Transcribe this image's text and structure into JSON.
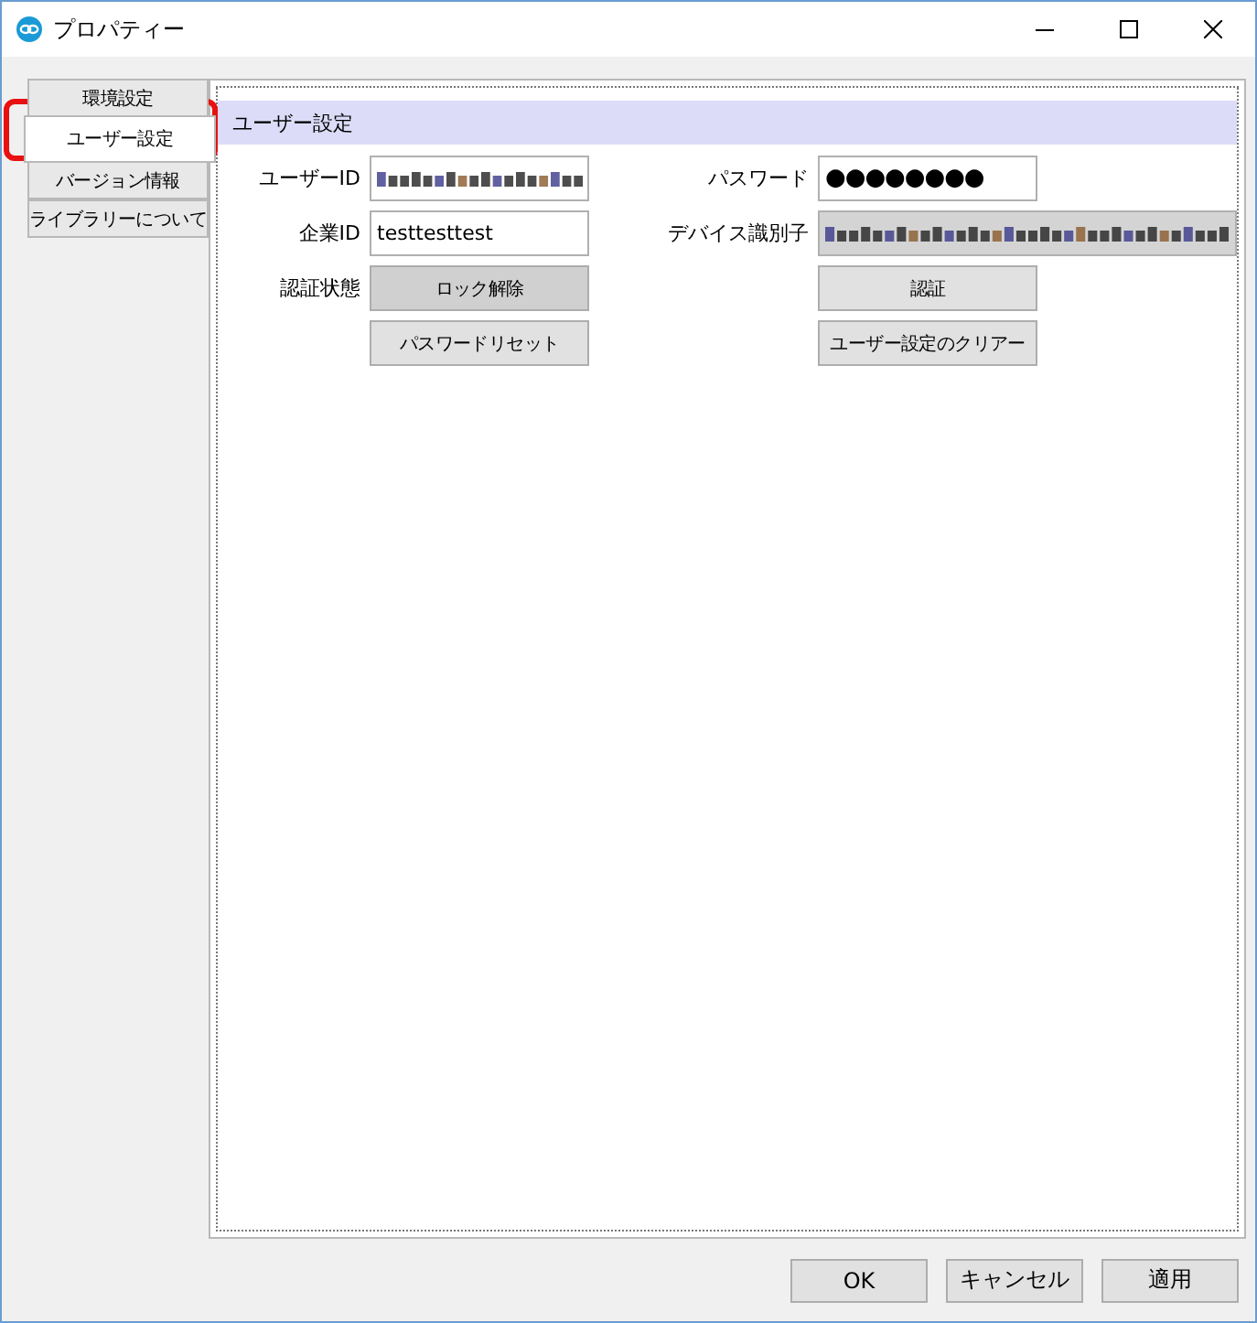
{
  "window": {
    "title": "プロパティー"
  },
  "tabs": [
    {
      "label": "環境設定",
      "selected": false
    },
    {
      "label": "ユーザー設定",
      "selected": true
    },
    {
      "label": "バージョン情報",
      "selected": false
    },
    {
      "label": "ライブラリーについて",
      "selected": false
    }
  ],
  "section": {
    "title": "ユーザー設定"
  },
  "left_rows": [
    {
      "label": "ユーザーID",
      "kind": "field",
      "redacted": true,
      "disabled": false
    },
    {
      "label": "企業ID",
      "kind": "field",
      "value": "testtesttest",
      "redacted": false,
      "disabled": false
    },
    {
      "label": "認証状態",
      "kind": "button",
      "value": "ロック解除",
      "disabled": true
    },
    {
      "kind": "button",
      "value": "パスワードリセット",
      "disabled": false
    }
  ],
  "right_rows": [
    {
      "label": "パスワード",
      "kind": "field",
      "value": "●●●●●●●●",
      "redacted": false,
      "disabled": false
    },
    {
      "label": "デバイス識別子",
      "kind": "field",
      "redacted": true,
      "disabled": true,
      "wide": true
    },
    {
      "kind": "button",
      "value": "認証",
      "disabled": false
    },
    {
      "kind": "button",
      "value": "ユーザー設定のクリアー",
      "disabled": false
    }
  ],
  "buttons": [
    "OK",
    "キャンセル",
    "適用"
  ],
  "highlight": {
    "shown": true
  }
}
